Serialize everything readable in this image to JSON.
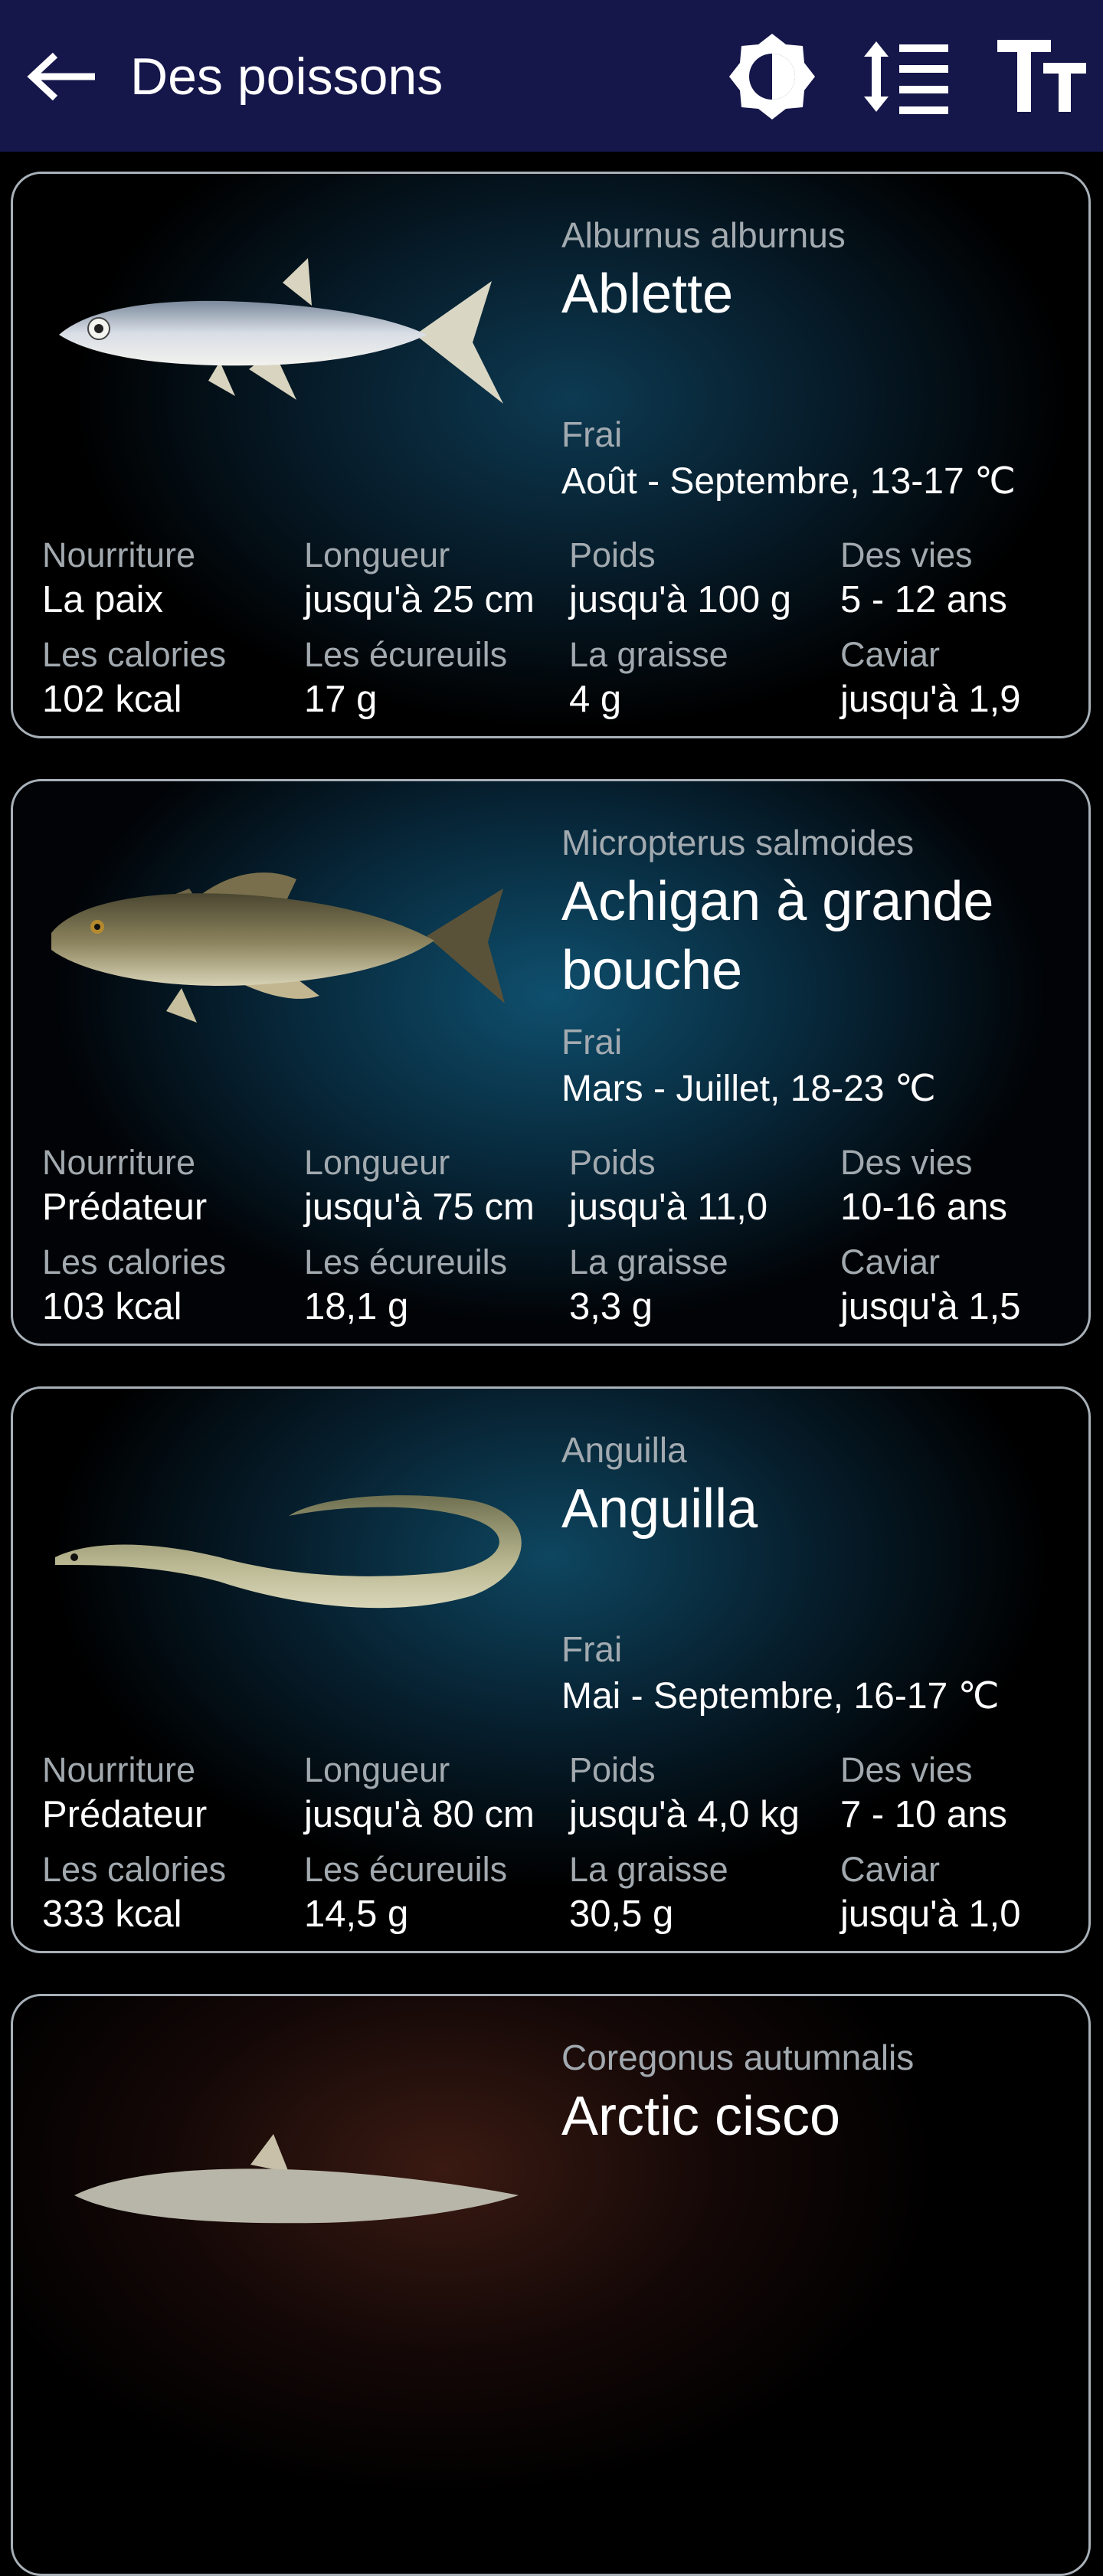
{
  "appbar": {
    "title": "Des poissons",
    "background": "#15164a",
    "icons": [
      "arrow-left-icon",
      "brightness-icon",
      "line-spacing-icon",
      "text-size-icon"
    ]
  },
  "labels": {
    "frai": "Frai",
    "nourriture": "Nourriture",
    "longueur": "Longueur",
    "poids": "Poids",
    "vies": "Des vies",
    "calories": "Les calories",
    "ecureuils": "Les écureuils",
    "graisse": "La graisse",
    "caviar": "Caviar"
  },
  "fish": [
    {
      "latin": "Alburnus alburnus",
      "name": "Ablette",
      "frai": "Août - Septembre, 13-17 ℃",
      "nourriture": "La paix",
      "longueur": "jusqu'à 25 cm",
      "poids": "jusqu'à 100 g",
      "vies": "5 - 12 ans",
      "calories": "102 kcal",
      "ecureuils": "17 g",
      "graisse": "4 g",
      "caviar": "jusqu'à 1,9"
    },
    {
      "latin": "Micropterus salmoides",
      "name": "Achigan à grande bouche",
      "frai": "Mars - Juillet, 18-23 ℃",
      "nourriture": "Prédateur",
      "longueur": "jusqu'à 75 cm",
      "poids": "jusqu'à 11,0",
      "vies": "10-16 ans",
      "calories": "103 kcal",
      "ecureuils": "18,1 g",
      "graisse": "3,3 g",
      "caviar": "jusqu'à 1,5"
    },
    {
      "latin": "Anguilla",
      "name": "Anguilla",
      "frai": "Mai - Septembre, 16-17 ℃",
      "nourriture": "Prédateur",
      "longueur": "jusqu'à 80 cm",
      "poids": "jusqu'à 4,0 kg",
      "vies": "7 - 10 ans",
      "calories": "333 kcal",
      "ecureuils": "14,5 g",
      "graisse": "30,5 g",
      "caviar": "jusqu'à 1,0"
    },
    {
      "latin": "Coregonus autumnalis",
      "name": "Arctic cisco"
    }
  ]
}
